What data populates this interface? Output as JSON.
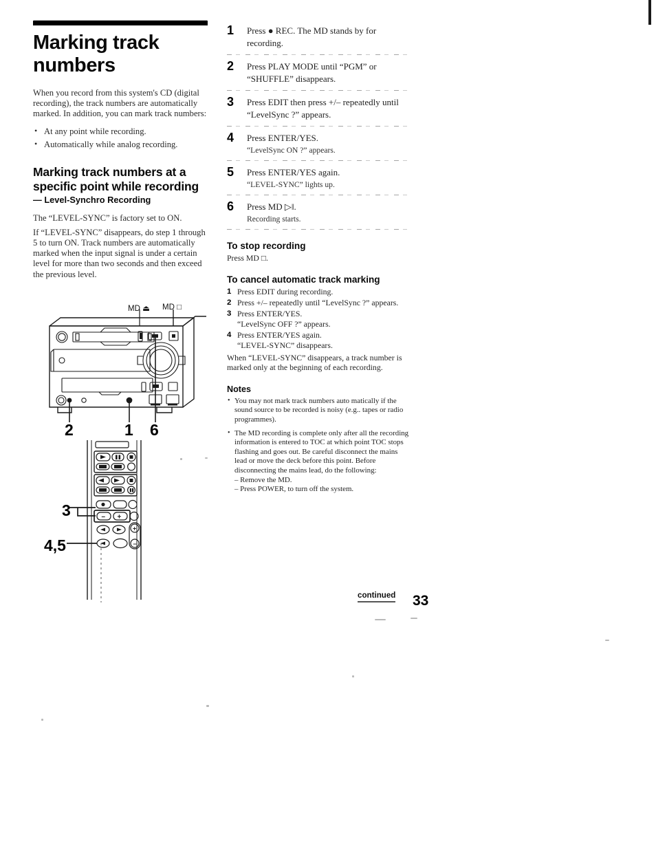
{
  "title": "Marking track numbers",
  "intro": "When you record from this system's CD (digital recording), the track numbers are automatically marked.  In addition, you can mark track numbers:",
  "intro_bullets": [
    "At any point while recording.",
    "Automatically while analog recording."
  ],
  "section": {
    "heading": "Marking track numbers at a specific point while recording",
    "subheading": "— Level-Synchro Recording",
    "paragraphs": [
      "The “LEVEL-SYNC” is factory set to ON.",
      "If “LEVEL-SYNC” disappears, do step 1 through 5 to turn ON. Track numbers are automatically marked when the input signal is under a certain level for more than two seconds and then exceed the previous level."
    ]
  },
  "steps": [
    {
      "num": "1",
      "text": "Press ● REC. The MD stands by for recording.",
      "sub": ""
    },
    {
      "num": "2",
      "text": "Press PLAY MODE until “PGM” or “SHUFFLE” disappears.",
      "sub": ""
    },
    {
      "num": "3",
      "text": "Press EDIT then press +/– repeatedly until “LevelSync ?” appears.",
      "sub": ""
    },
    {
      "num": "4",
      "text": "Press ENTER/YES.",
      "sub": "“LevelSync ON ?” appears."
    },
    {
      "num": "5",
      "text": "Press ENTER/YES again.",
      "sub": "“LEVEL-SYNC” lights up."
    },
    {
      "num": "6",
      "text": "Press MD ▷‖.",
      "sub": "Recording starts."
    }
  ],
  "stop_recording": {
    "heading": "To stop recording",
    "text": "Press MD □."
  },
  "cancel_marking": {
    "heading": "To cancel automatic track marking",
    "steps": [
      {
        "num": "1",
        "text": "Press EDIT during recording.",
        "sub": ""
      },
      {
        "num": "2",
        "text": "Press +/– repeatedly until “LevelSync ?” appears.",
        "sub": ""
      },
      {
        "num": "3",
        "text": "Press ENTER/YES.",
        "sub": "“LevelSync OFF ?” appears."
      },
      {
        "num": "4",
        "text": "Press ENTER/YES again.",
        "sub": "“LEVEL-SYNC” disappears."
      }
    ],
    "closing": "When “LEVEL-SYNC” disappears, a track number is marked only at the beginning of each recording."
  },
  "notes": {
    "heading": "Notes",
    "items": [
      "You may not mark track numbers auto matically if the sound source to be recorded is noisy (e.g.. tapes or radio programmes).",
      "The MD recording is complete only after all the recording information is entered to TOC at which point TOC stops flashing and goes out. Be careful disconnect the mains lead or move the deck before this point. Before disconnecting the mains lead, do the following:"
    ],
    "sub_items": [
      "– Remove the MD.",
      "– Press POWER, to turn off the system."
    ]
  },
  "figures": {
    "deck": {
      "label_eject": "MD ⏏",
      "label_stop": "MD □",
      "callouts": [
        "2",
        "1",
        "6"
      ]
    },
    "remote": {
      "callouts": [
        "3",
        "4,5"
      ]
    }
  },
  "footer": {
    "continued": "continued",
    "page_number": "33"
  }
}
